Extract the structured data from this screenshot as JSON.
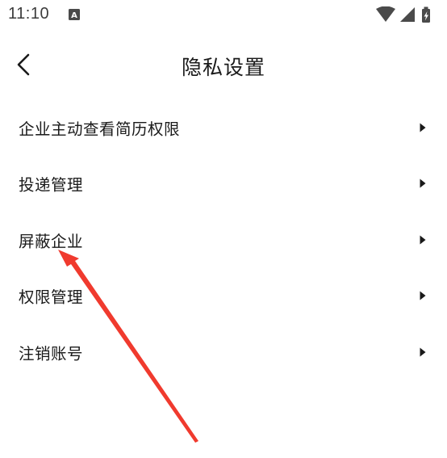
{
  "status_bar": {
    "time": "11:10",
    "notification_icon": "a-letter-badge-icon",
    "wifi_icon": "wifi-icon",
    "signal_icon": "cell-signal-icon",
    "battery_icon": "battery-charging-icon"
  },
  "header": {
    "back_icon": "back-chevron-icon",
    "title": "隐私设置"
  },
  "menu": {
    "items": [
      {
        "label": "企业主动查看简历权限",
        "icon": "chevron-right-icon"
      },
      {
        "label": "投递管理",
        "icon": "chevron-right-icon"
      },
      {
        "label": "屏蔽企业",
        "icon": "chevron-right-icon"
      },
      {
        "label": "权限管理",
        "icon": "chevron-right-icon"
      },
      {
        "label": "注销账号",
        "icon": "chevron-right-icon"
      }
    ]
  },
  "annotation": {
    "color": "#f03a2e",
    "target": "屏蔽企业"
  }
}
